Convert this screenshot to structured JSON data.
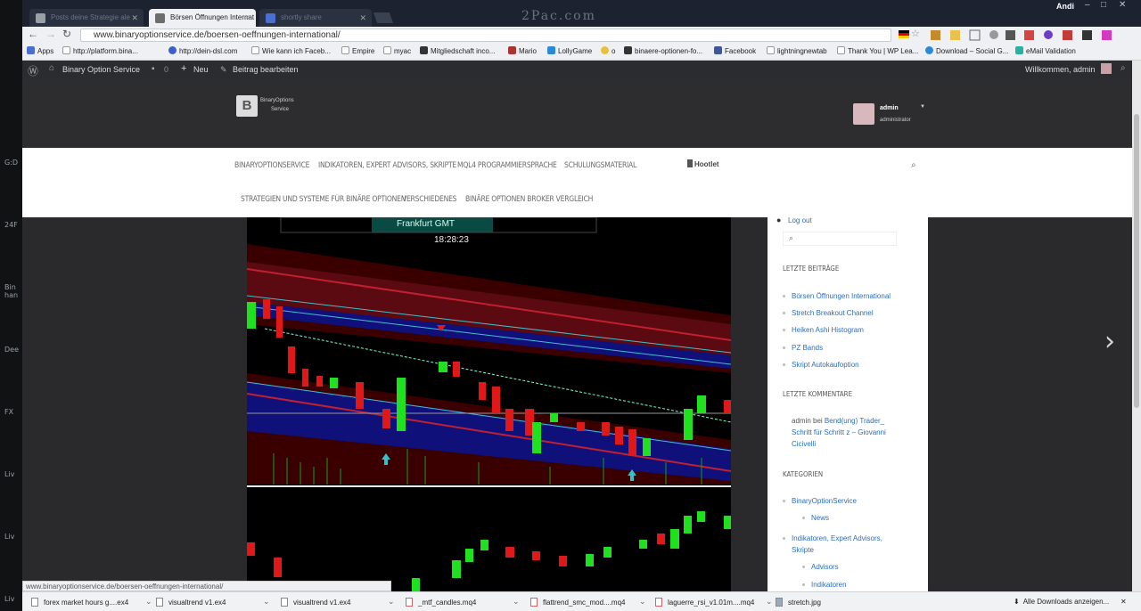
{
  "side_panel": {
    "items": [
      "G:D",
      "24F",
      "Bin han",
      "Dee",
      "FX",
      "Liv",
      "Liv",
      "Liv"
    ]
  },
  "window": {
    "watermark": "2Pac.com",
    "user": "Andi"
  },
  "tabs": [
    {
      "title": "Posts deine Strategie ale"
    },
    {
      "title": "Börsen Öffnungen Internat"
    },
    {
      "title": "shortly share"
    }
  ],
  "address_bar": {
    "url": "www.binaryoptionservice.de/boersen-oeffnungen-international/"
  },
  "bookmarks": [
    "Apps",
    "http://platform.bina...",
    "http://dein-dsl.com",
    "Wie kann ich Faceb...",
    "Empire",
    "myac",
    "Mitgliedschaft inco...",
    "Mario",
    "LollyGame",
    "o",
    "binaere-optionen-fo...",
    "Facebook",
    "lightningnewtab",
    "Thank You | WP Lea...",
    "Download – Social G...",
    "eMail Validation"
  ],
  "admin_bar": {
    "site": "Binary Option Service",
    "comments": "0",
    "new": "Neu",
    "edit": "Beitrag bearbeiten",
    "greeting": "Willkommen, admin"
  },
  "header": {
    "logo_line1": "BinaryOptions",
    "logo_line2": "Service",
    "user_name": "admin",
    "user_role": "administrator"
  },
  "nav": {
    "row1": [
      "BinaryOptionService",
      "Indikatoren, Expert Advisors, Skripte",
      "MQL4 Programmiersprache",
      "Schulungsmaterial"
    ],
    "hootlet": "Hootlet",
    "row2": [
      "Strategien und Systeme für binäre Optionen",
      "Verschiedenes",
      "Binäre Optionen Broker Vergleich"
    ]
  },
  "chart": {
    "session_label": "Frankfurt GMT",
    "clock": "18:28:23"
  },
  "sidebar": {
    "logout": "Log out",
    "recent_posts_title": "Letzte Beiträge",
    "recent_posts": [
      "Börsen Öffnungen International",
      "Stretch Breakout Channel",
      "Heiken Ashi Histogram",
      "PZ Bands",
      "Skript Autokaufoption"
    ],
    "recent_comments_title": "Letzte Kommentare",
    "comment_author": "admin bei",
    "comment_link": "Bend(ung) Trader_ Schritt für Schritt z – Giovanni Cicivelli",
    "categories_title": "Kategorien",
    "categories": [
      {
        "label": "BinaryOptionService",
        "indent": 0
      },
      {
        "label": "News",
        "indent": 1
      },
      {
        "label": "Indikatoren, Expert Advisors, Skripte",
        "indent": 0
      },
      {
        "label": "Advisors",
        "indent": 1
      },
      {
        "label": "Indikatoren",
        "indent": 1
      }
    ]
  },
  "status_url": "www.binaryoptionservice.de/boersen-oeffnungen-international/",
  "downloads": {
    "items": [
      "forex market hours g....ex4",
      "visualtrend v1.ex4",
      "visualtrend v1.ex4",
      "_mtf_candles.mq4",
      "flattrend_smc_mod....mq4",
      "laguerre_rsi_v1.01m....mq4",
      "stretch.jpg"
    ],
    "show_all": "Alle Downloads anzeigen..."
  }
}
